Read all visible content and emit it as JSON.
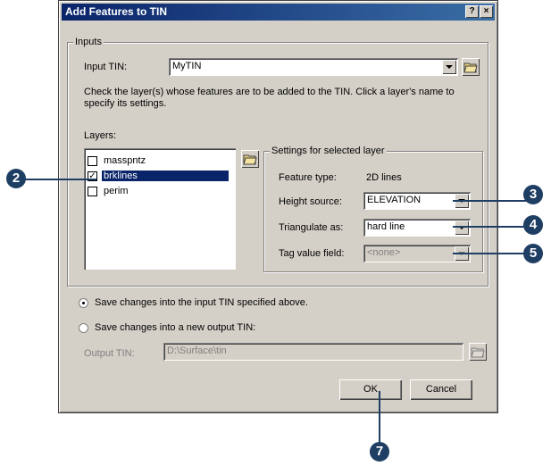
{
  "window": {
    "title": "Add Features to TIN",
    "help_btn": "?",
    "close_btn": "×"
  },
  "inputs": {
    "group_label": "Inputs",
    "input_tin_label": "Input TIN:",
    "input_tin_value": "MyTIN",
    "instructions": "Check the layer(s) whose features are to be added to the TIN.  Click a layer's name to specify its settings.",
    "layers_label": "Layers:",
    "layers": [
      {
        "name": "masspntz",
        "checked": false,
        "selected": false
      },
      {
        "name": "brklines",
        "checked": true,
        "selected": true
      },
      {
        "name": "perim",
        "checked": false,
        "selected": false
      }
    ]
  },
  "settings": {
    "group_label": "Settings for selected layer",
    "feature_type_label": "Feature type:",
    "feature_type_value": "2D lines",
    "height_source_label": "Height source:",
    "height_source_value": "ELEVATION",
    "triangulate_label": "Triangulate as:",
    "triangulate_value": "hard line",
    "tag_value_label": "Tag value field:",
    "tag_value_value": "<none>"
  },
  "output": {
    "save_input_label": "Save changes into the input TIN specified above.",
    "save_new_label": "Save changes into a new output TIN:",
    "output_tin_label": "Output TIN:",
    "output_tin_value": "D:\\Surface\\tin",
    "selected_option": "save_input"
  },
  "buttons": {
    "ok": "OK",
    "cancel": "Cancel"
  },
  "callouts": [
    "2",
    "3",
    "4",
    "5",
    "7"
  ]
}
